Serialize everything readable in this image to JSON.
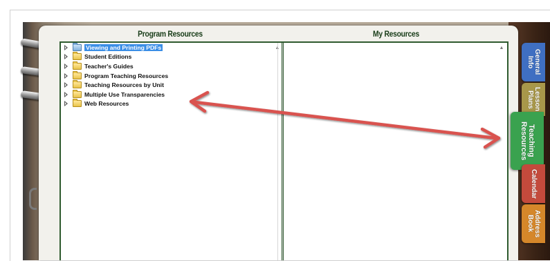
{
  "panels": {
    "program": {
      "title": "Program Resources"
    },
    "mine": {
      "title": "My Resources"
    }
  },
  "tree": [
    {
      "label": "Viewing and Printing PDFs",
      "selected": true,
      "icon": "folder-blue-icon"
    },
    {
      "label": "Student Editions",
      "icon": "folder-icon"
    },
    {
      "label": "Teacher's Guides",
      "icon": "folder-icon"
    },
    {
      "label": "Program Teaching Resources",
      "icon": "folder-icon"
    },
    {
      "label": "Teaching Resources by Unit",
      "icon": "folder-icon"
    },
    {
      "label": "Multiple Use Transparencies",
      "icon": "folder-icon"
    },
    {
      "label": "Web Resources",
      "icon": "folder-icon"
    }
  ],
  "tabs": [
    {
      "label": "General\nInfo",
      "color": "#3f6fc2"
    },
    {
      "label": "Lesson\nPlans",
      "color": "#a8974a"
    },
    {
      "label": "Teaching\nResources",
      "color": "#3aa24f",
      "active": true
    },
    {
      "label": "Calendar",
      "color": "#c44a3c"
    },
    {
      "label": "Address\nBook",
      "color": "#d5872a"
    }
  ],
  "colors": {
    "header_text": "#173b17",
    "panel_border": "#2e5a2e",
    "selection": "#3a8ee6",
    "annotation_arrow": "#d9534f"
  }
}
